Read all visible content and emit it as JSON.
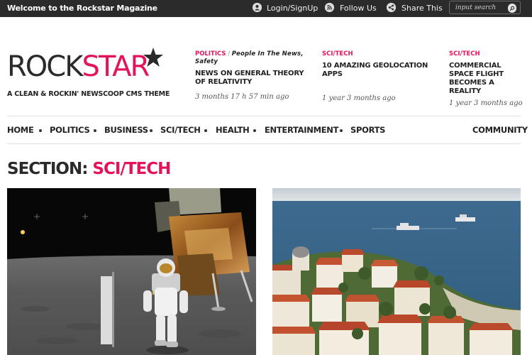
{
  "topbar": {
    "welcome": "Welcome to the Rockstar Magazine",
    "login": "Login/SignUp",
    "follow": "Follow Us",
    "share": "Share This",
    "search_placeholder": "input search",
    "login_icon": "user-icon",
    "follow_icon": "rss-icon",
    "share_icon": "share-icon",
    "search_icon": "search-icon"
  },
  "logo": {
    "part1": "ROCK",
    "part2": "STAR",
    "tagline": "A CLEAN & ROCKIN' NEWSCOOP CMS THEME"
  },
  "featured": [
    {
      "category": "POLITICS",
      "tags": "People In The News, Safety",
      "title": "NEWS ON GENERAL THEORY OF RELATIVITY",
      "time": "3 months 17 h 57 min ago"
    },
    {
      "category": "SCI/TECH",
      "tags": "",
      "title": "10 AMAZING GEOLOCATION APPS",
      "time": "1 year 3 months ago"
    },
    {
      "category": "SCI/TECH",
      "tags": "",
      "title": "COMMERCIAL SPACE FLIGHT BECOMES A REALITY",
      "time": "1 year 3 months ago"
    }
  ],
  "nav": {
    "items": [
      "HOME",
      "POLITICS",
      "BUSINESS",
      "SCI/TECH",
      "HEALTH",
      "ENTERTAINMENT",
      "SPORTS"
    ],
    "community": "COMMUNITY"
  },
  "section": {
    "label": "SECTION:",
    "name": "SCI/TECH"
  },
  "colors": {
    "accent": "#e3135c",
    "topbar": "#2b2b2b",
    "text": "#222222"
  }
}
